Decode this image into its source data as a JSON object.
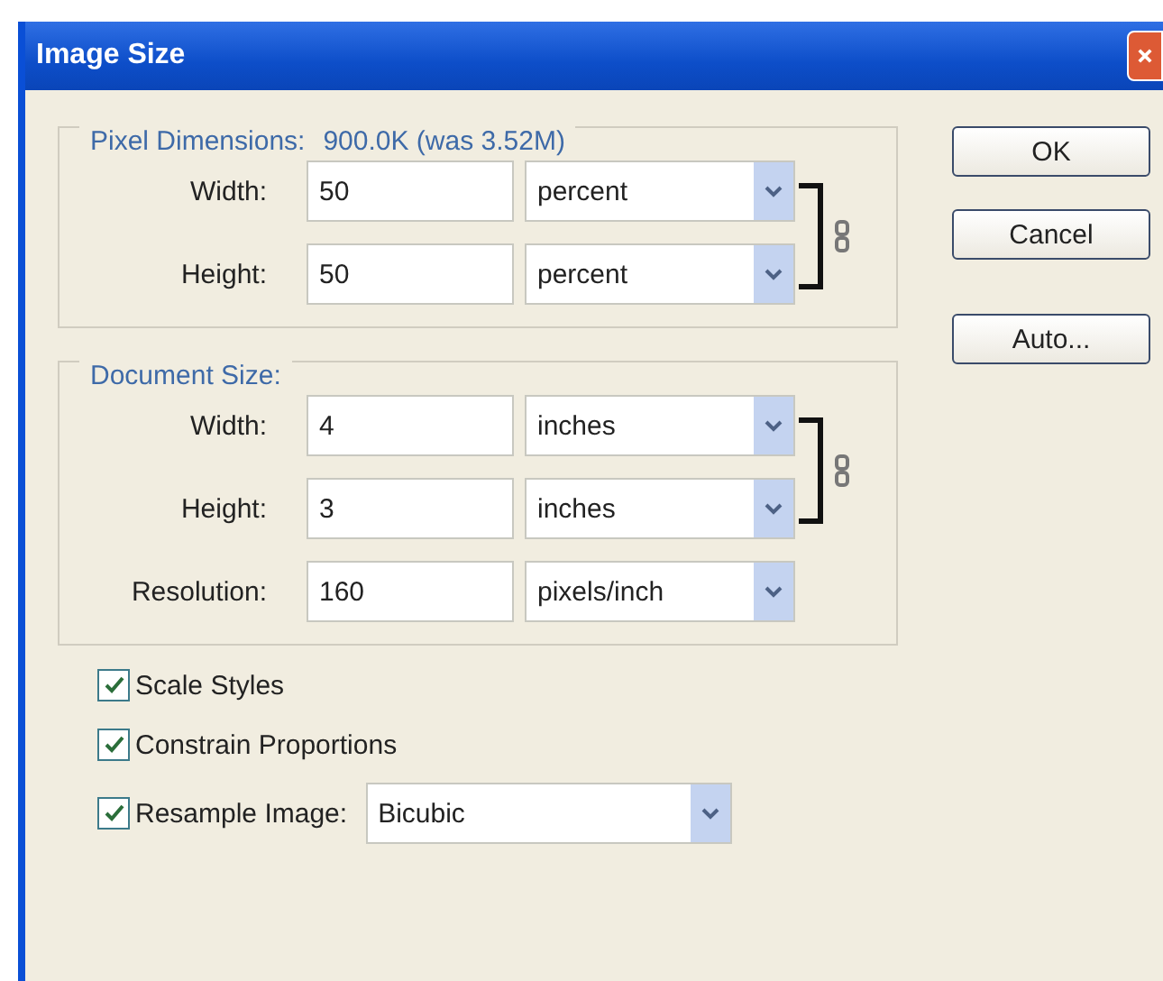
{
  "window": {
    "title": "Image Size"
  },
  "pixel_dimensions": {
    "label": "Pixel Dimensions:",
    "size": "900.0K (was 3.52M)",
    "linked": true,
    "fields": [
      {
        "label": "Width:",
        "value": "50",
        "unit": "percent"
      },
      {
        "label": "Height:",
        "value": "50",
        "unit": "percent"
      }
    ]
  },
  "document_size": {
    "label": "Document Size:",
    "linked": true,
    "fields": [
      {
        "label": "Width:",
        "value": "4",
        "unit": "inches"
      },
      {
        "label": "Height:",
        "value": "3",
        "unit": "inches"
      },
      {
        "label": "Resolution:",
        "value": "160",
        "unit": "pixels/inch"
      }
    ]
  },
  "options": [
    {
      "label": "Scale Styles",
      "checked": true
    },
    {
      "label": "Constrain Proportions",
      "checked": true
    },
    {
      "label": "Resample Image:",
      "checked": true,
      "method": "Bicubic"
    }
  ],
  "buttons": [
    "OK",
    "Cancel",
    "Auto..."
  ]
}
